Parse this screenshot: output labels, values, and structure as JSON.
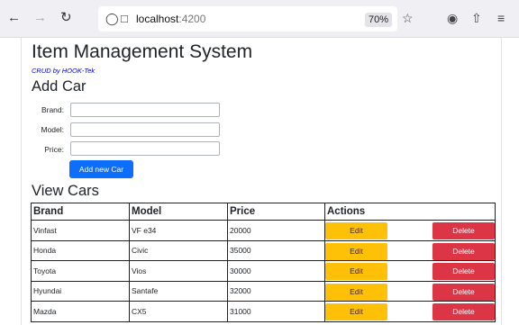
{
  "browser": {
    "url_host": "localhost",
    "url_port": ":4200",
    "zoom": "70%"
  },
  "page": {
    "title": "Item Management System",
    "subtitle": "CRUD by HOOK-Tek",
    "add_heading": "Add Car",
    "form": {
      "brand_label": "Brand:",
      "brand_value": "",
      "model_label": "Model:",
      "model_value": "",
      "price_label": "Price:",
      "price_value": "",
      "submit_label": "Add new Car"
    },
    "view_heading": "View Cars",
    "table": {
      "headers": [
        "Brand",
        "Model",
        "Price",
        "Actions"
      ],
      "rows": [
        {
          "brand": "Vinfast",
          "model": "VF e34",
          "price": "20000"
        },
        {
          "brand": "Honda",
          "model": "Civic",
          "price": "35000"
        },
        {
          "brand": "Toyota",
          "model": "Vios",
          "price": "30000"
        },
        {
          "brand": "Hyundai",
          "model": "Santafe",
          "price": "32000"
        },
        {
          "brand": "Mazda",
          "model": "CX5",
          "price": "31000"
        }
      ],
      "edit_label": "Edit",
      "delete_label": "Delete"
    }
  },
  "colors": {
    "primary": "#0d6efd",
    "warning": "#ffc107",
    "danger": "#dc3545",
    "subtitle": "#0000cc"
  },
  "icons": [
    "back-arrow-icon",
    "forward-arrow-icon",
    "reload-icon",
    "shield-icon",
    "page-icon",
    "star-icon",
    "pocket-icon",
    "share-icon",
    "menu-icon"
  ]
}
